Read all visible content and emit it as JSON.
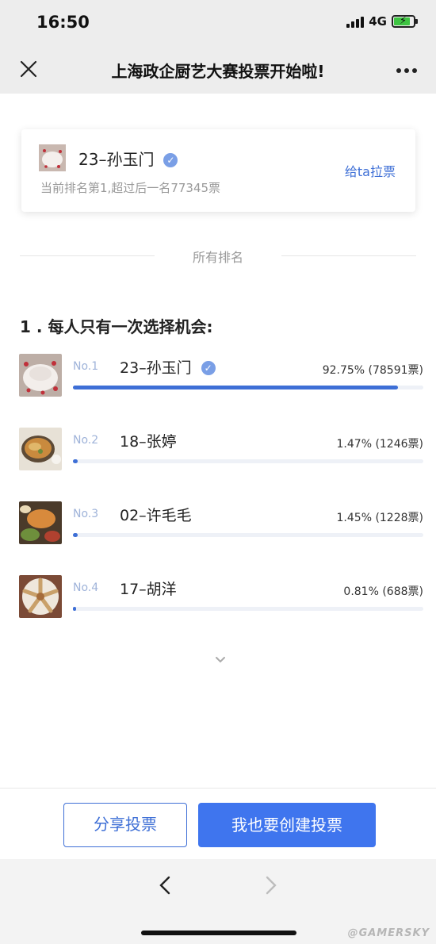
{
  "status_bar": {
    "time": "16:50",
    "network": "4G",
    "battery_color": "#3ec442"
  },
  "nav": {
    "title": "上海政企厨艺大赛投票开始啦!",
    "close_icon": "close-icon",
    "more_icon": "more-icon"
  },
  "card": {
    "name": "23–孙玉门",
    "subtitle": "当前排名第1,超过后一名77345票",
    "action_label": "给ta拉票",
    "verified_icon": "check-circle-icon"
  },
  "divider": {
    "label": "所有排名"
  },
  "question": {
    "text": "1 . 每人只有一次选择机会:"
  },
  "ranking": [
    {
      "no": "No.1",
      "name": "23–孙玉门",
      "stat": "92.75% (78591票)",
      "percent": 92.75,
      "verified": true
    },
    {
      "no": "No.2",
      "name": "18–张婷",
      "stat": "1.47% (1246票)",
      "percent": 1.47,
      "verified": false
    },
    {
      "no": "No.3",
      "name": "02–许毛毛",
      "stat": "1.45% (1228票)",
      "percent": 1.45,
      "verified": false
    },
    {
      "no": "No.4",
      "name": "17–胡洋",
      "stat": "0.81% (688票)",
      "percent": 0.81,
      "verified": false
    }
  ],
  "actions": {
    "share_label": "分享投票",
    "create_label": "我也要创建投票"
  },
  "browser": {
    "back_icon": "chevron-left-icon",
    "forward_icon": "chevron-right-icon"
  },
  "colors": {
    "accent": "#3e6fd6",
    "primary_button": "#3f75ee",
    "bar_track": "#eef1f7"
  }
}
